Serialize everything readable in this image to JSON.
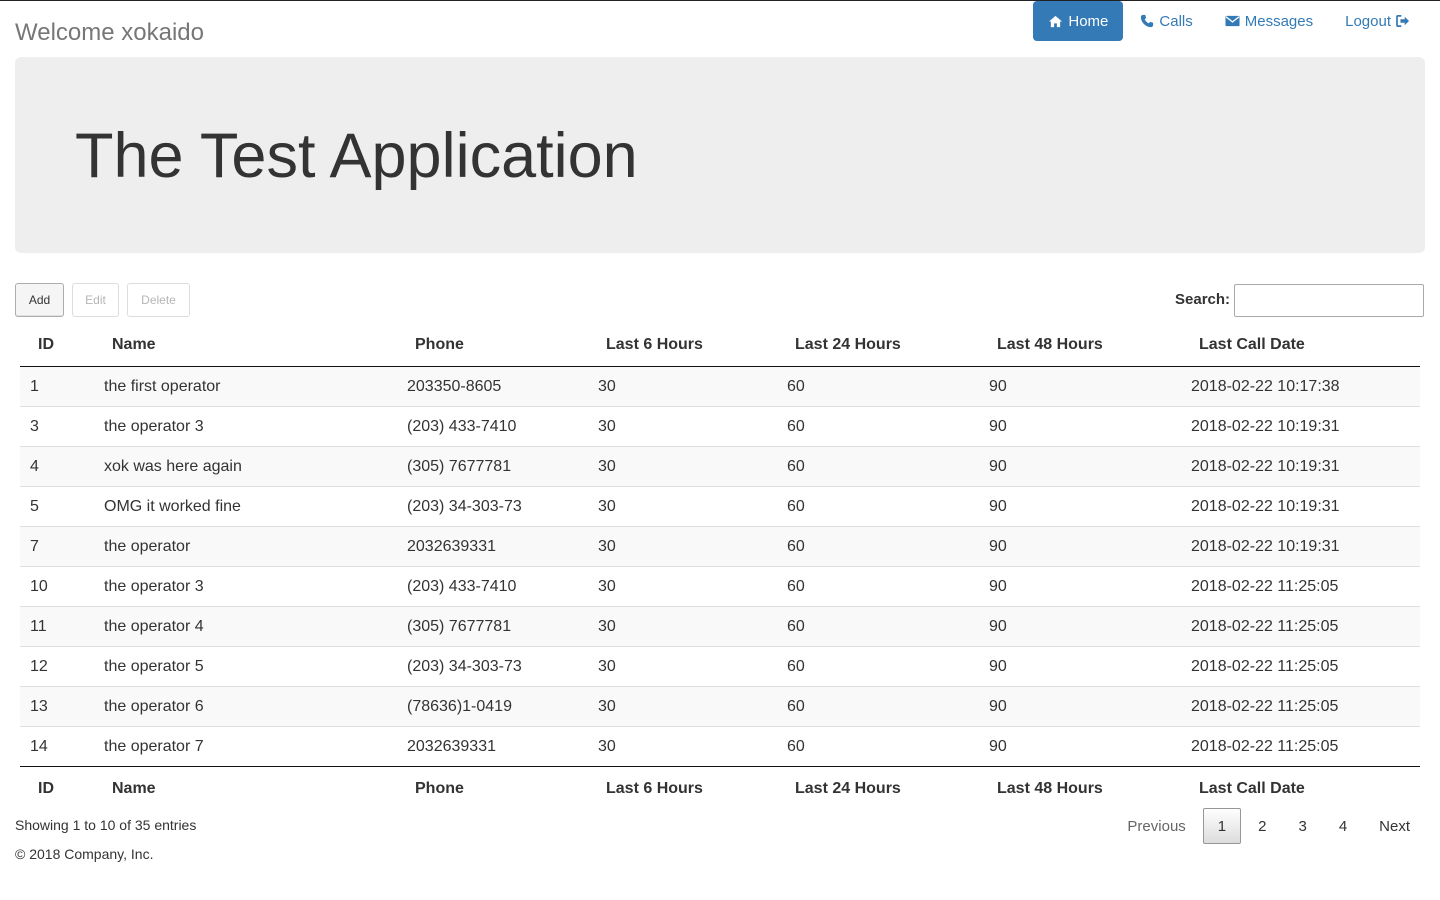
{
  "header": {
    "welcome": "Welcome xokaido"
  },
  "nav": {
    "home": "Home",
    "calls": "Calls",
    "messages": "Messages",
    "logout": "Logout"
  },
  "hero": {
    "title": "The Test Application"
  },
  "toolbar": {
    "add": "Add",
    "edit": "Edit",
    "delete": "Delete",
    "search_label": "Search:",
    "search_value": ""
  },
  "table": {
    "columns": [
      "ID",
      "Name",
      "Phone",
      "Last 6 Hours",
      "Last 24 Hours",
      "Last 48 Hours",
      "Last Call Date"
    ],
    "rows": [
      [
        "1",
        "the first operator",
        "203350-8605",
        "30",
        "60",
        "90",
        "2018-02-22 10:17:38"
      ],
      [
        "3",
        "the operator 3",
        "(203) 433-7410",
        "30",
        "60",
        "90",
        "2018-02-22 10:19:31"
      ],
      [
        "4",
        "xok was here again",
        "(305) 7677781",
        "30",
        "60",
        "90",
        "2018-02-22 10:19:31"
      ],
      [
        "5",
        "OMG it worked fine",
        "(203) 34-303-73",
        "30",
        "60",
        "90",
        "2018-02-22 10:19:31"
      ],
      [
        "7",
        "the operator",
        "2032639331",
        "30",
        "60",
        "90",
        "2018-02-22 10:19:31"
      ],
      [
        "10",
        "the operator 3",
        "(203) 433-7410",
        "30",
        "60",
        "90",
        "2018-02-22 11:25:05"
      ],
      [
        "11",
        "the operator 4",
        "(305) 7677781",
        "30",
        "60",
        "90",
        "2018-02-22 11:25:05"
      ],
      [
        "12",
        "the operator 5",
        "(203) 34-303-73",
        "30",
        "60",
        "90",
        "2018-02-22 11:25:05"
      ],
      [
        "13",
        "the operator 6",
        "(78636)1-0419",
        "30",
        "60",
        "90",
        "2018-02-22 11:25:05"
      ],
      [
        "14",
        "the operator 7",
        "2032639331",
        "30",
        "60",
        "90",
        "2018-02-22 11:25:05"
      ]
    ]
  },
  "footer": {
    "info": "Showing 1 to 10 of 35 entries",
    "copyright": "© 2018 Company, Inc."
  },
  "pagination": {
    "previous": "Previous",
    "pages": [
      "1",
      "2",
      "3",
      "4"
    ],
    "current": "1",
    "next": "Next"
  },
  "colors": {
    "brand": "#337ab7",
    "jumbotron_bg": "#eeeeee"
  },
  "icons": {
    "home": "home-icon",
    "calls": "phone-icon",
    "messages": "envelope-icon",
    "logout": "sign-out-icon"
  }
}
